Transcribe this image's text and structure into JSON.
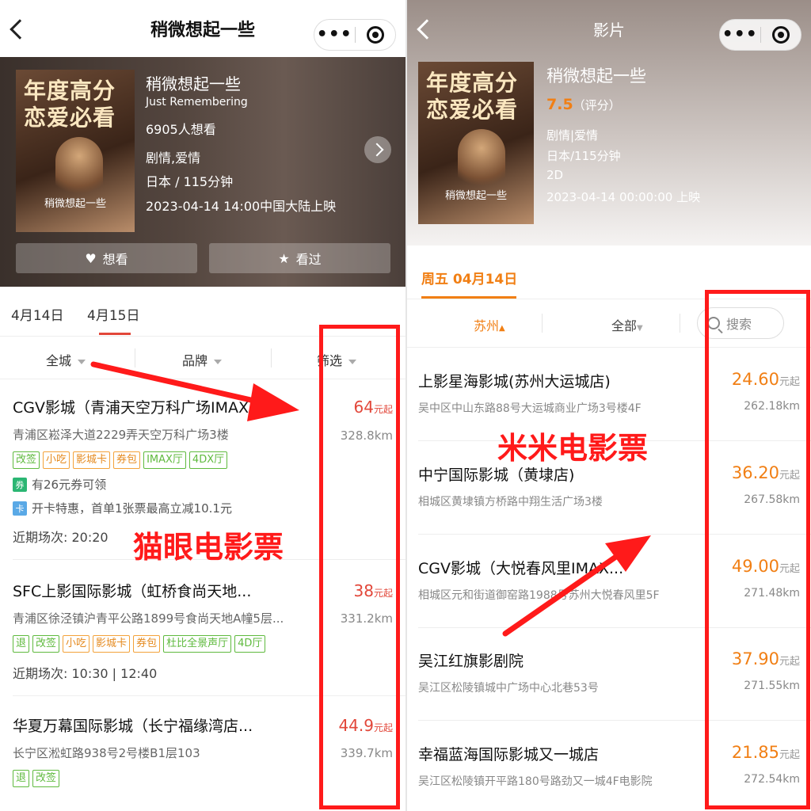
{
  "left": {
    "nav": {
      "title": "稍微想起一些"
    },
    "movie": {
      "poster_title_line1": "年度高分",
      "poster_title_line2": "恋爱必看",
      "poster_sub": "稍微想起一些",
      "title": "稍微想起一些",
      "english": "Just Remembering",
      "want_count": "6905人想看",
      "genre": "剧情,爱情",
      "region_duration": "日本 / 115分钟",
      "release": "2023-04-14 14:00中国大陆上映"
    },
    "buttons": {
      "want": "想看",
      "seen": "看过"
    },
    "date_tabs": [
      "4月14日",
      "4月15日"
    ],
    "filters": [
      "全城",
      "品牌",
      "筛选"
    ],
    "cinemas": [
      {
        "name": "CGV影城（青浦天空万科广场IMAX",
        "address": "青浦区崧泽大道2229弄天空万科广场3楼",
        "price": "64",
        "price_unit": "元起",
        "distance": "328.8km",
        "tags": [
          "改签",
          "小吃",
          "影城卡",
          "券包",
          "IMAX厅",
          "4DX厅"
        ],
        "promo1_icon": "券",
        "promo1": "有26元券可领",
        "promo2_icon": "卡",
        "promo2": "开卡特惠，首单1张票最高立减10.1元",
        "recent": "近期场次: 20:20"
      },
      {
        "name": "SFC上影国际影城（虹桥食尚天地...",
        "address": "青浦区徐泾镇沪青平公路1899号食尚天地A幢5层...",
        "price": "38",
        "price_unit": "元起",
        "distance": "331.2km",
        "tags": [
          "退",
          "改签",
          "小吃",
          "影城卡",
          "券包",
          "杜比全景声厅",
          "4D厅"
        ],
        "recent": "近期场次: 10:30 | 12:40"
      },
      {
        "name": "华夏万幕国际影城（长宁福缘湾店...",
        "address": "长宁区淞虹路938号2号楼B1层103",
        "price": "44.9",
        "price_unit": "元起",
        "distance": "339.7km",
        "tags": [
          "退",
          "改签"
        ]
      }
    ],
    "annotation": "猫眼电影票"
  },
  "right": {
    "nav": {
      "title": "影片"
    },
    "movie": {
      "poster_title_line1": "年度高分",
      "poster_title_line2": "恋爱必看",
      "poster_sub": "稍微想起一些",
      "title": "稍微想起一些",
      "score": "7.5",
      "score_label": "（评分）",
      "genre": "剧情|爱情",
      "region_duration": "日本/115分钟",
      "format": "2D",
      "release": "2023-04-14 00:00:00 上映"
    },
    "date_tab": "周五 04月14日",
    "filters": {
      "city": "苏州",
      "all": "全部",
      "search_placeholder": "搜索"
    },
    "cinemas": [
      {
        "name": "上影星海影城(苏州大运城店)",
        "address": "吴中区中山东路88号大运城商业广场3号楼4F",
        "price": "24.60",
        "price_unit": "元起",
        "distance": "262.18km"
      },
      {
        "name": "中宁国际影城（黄埭店)",
        "address": "相城区黄埭镇方桥路中翔生活广场3楼",
        "price": "36.20",
        "price_unit": "元起",
        "distance": "267.58km"
      },
      {
        "name": "CGV影城（大悦春风里IMAX...",
        "address": "相城区元和街道御窑路1988号苏州大悦春风里5F",
        "price": "49.00",
        "price_unit": "元起",
        "distance": "271.48km"
      },
      {
        "name": "吴江红旗影剧院",
        "address": "吴江区松陵镇城中广场中心北巷53号",
        "price": "37.90",
        "price_unit": "元起",
        "distance": "271.55km"
      },
      {
        "name": "幸福蓝海国际影城又一城店",
        "address": "吴江区松陵镇开平路180号路劲又一城4F电影院",
        "price": "21.85",
        "price_unit": "元起",
        "distance": "272.54km"
      }
    ],
    "annotation": "米米电影票"
  },
  "colors": {
    "maoyan_red": "#e2473a",
    "mimi_orange": "#f17f14",
    "annotation_red": "#ff1a1a"
  }
}
